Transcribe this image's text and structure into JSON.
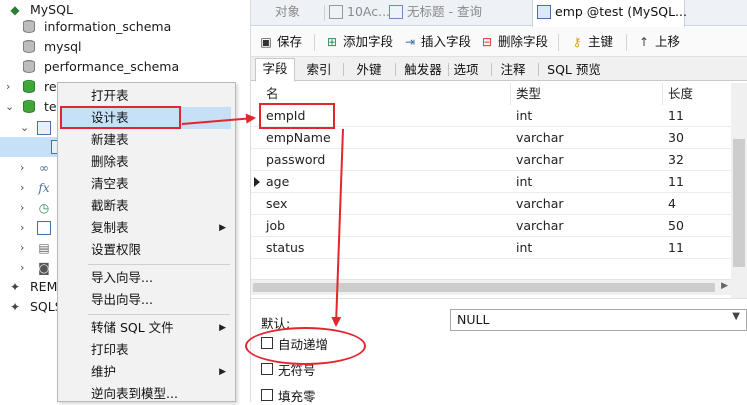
{
  "tree": {
    "items": [
      {
        "label": "MySQL"
      },
      {
        "label": "information_schema"
      },
      {
        "label": "mysql"
      },
      {
        "label": "performance_schema"
      },
      {
        "label": "re"
      },
      {
        "label": "tes"
      },
      {
        "label": "REM"
      },
      {
        "label": "SQLS"
      }
    ]
  },
  "context_menu": {
    "items": [
      {
        "label": "打开表"
      },
      {
        "label": "设计表"
      },
      {
        "label": "新建表"
      },
      {
        "label": "删除表"
      },
      {
        "label": "清空表"
      },
      {
        "label": "截断表"
      },
      {
        "label": "复制表"
      },
      {
        "label": "设置权限"
      },
      {
        "label": "导入向导..."
      },
      {
        "label": "导出向导..."
      },
      {
        "label": "转储 SQL 文件"
      },
      {
        "label": "打印表"
      },
      {
        "label": "维护"
      },
      {
        "label": "逆向表到模型..."
      }
    ],
    "selected": "设计表"
  },
  "window_tabs": [
    {
      "label": "对象"
    },
    {
      "label": "10Ac..."
    },
    {
      "label": "无标题 - 查询"
    },
    {
      "label": "emp @test (MySQL..."
    }
  ],
  "toolbar": {
    "save": "保存",
    "add_field": "添加字段",
    "insert_field": "插入字段",
    "delete_field": "删除字段",
    "primary_key": "主键",
    "move_up": "上移"
  },
  "sub_tabs": [
    "字段",
    "索引",
    "外键",
    "触发器",
    "选项",
    "注释",
    "SQL 预览"
  ],
  "grid": {
    "headers": [
      "名",
      "类型",
      "长度"
    ],
    "rows": [
      {
        "name": "empId",
        "type": "int",
        "length": "11"
      },
      {
        "name": "empName",
        "type": "varchar",
        "length": "30"
      },
      {
        "name": "password",
        "type": "varchar",
        "length": "32"
      },
      {
        "name": "age",
        "type": "int",
        "length": "11"
      },
      {
        "name": "sex",
        "type": "varchar",
        "length": "4"
      },
      {
        "name": "job",
        "type": "varchar",
        "length": "50"
      },
      {
        "name": "status",
        "type": "int",
        "length": "11"
      }
    ],
    "current_row": "age"
  },
  "properties": {
    "default_label": "默认:",
    "default_value": "NULL",
    "auto_increment": "自动递增",
    "unsigned": "无符号",
    "zerofill": "填充零"
  },
  "annotation_color": "#e3262e"
}
